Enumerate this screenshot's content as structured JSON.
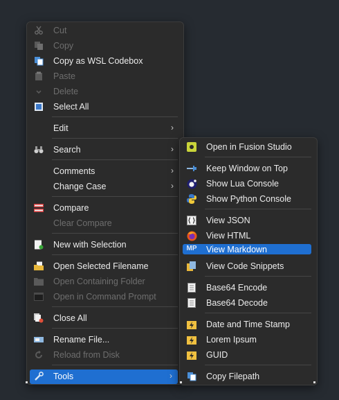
{
  "main_menu": {
    "items": [
      {
        "label": "Cut",
        "icon": "scissors-icon",
        "disabled": true
      },
      {
        "label": "Copy",
        "icon": "copy-icon",
        "disabled": true
      },
      {
        "label": "Copy as WSL Codebox",
        "icon": "copy-icon",
        "disabled": false
      },
      {
        "label": "Paste",
        "icon": "paste-icon",
        "disabled": true
      },
      {
        "label": "Delete",
        "icon": "delete-icon",
        "disabled": true
      },
      {
        "label": "Select All",
        "icon": "select-all-icon",
        "disabled": false
      },
      {
        "label": "Edit",
        "submenu": true
      },
      {
        "label": "Search",
        "icon": "binoculars-icon",
        "submenu": true
      },
      {
        "label": "Comments",
        "submenu": true
      },
      {
        "label": "Change Case",
        "submenu": true
      },
      {
        "label": "Compare",
        "icon": "compare-icon",
        "disabled": false
      },
      {
        "label": "Clear Compare",
        "disabled": true
      },
      {
        "label": "New with Selection",
        "icon": "new-document-icon",
        "disabled": false
      },
      {
        "label": "Open Selected Filename",
        "icon": "open-folder-icon",
        "disabled": false
      },
      {
        "label": "Open Containing Folder",
        "icon": "folder-icon",
        "disabled": true
      },
      {
        "label": "Open in Command Prompt",
        "icon": "command-prompt-icon",
        "disabled": true
      },
      {
        "label": "Close All",
        "icon": "close-all-icon",
        "disabled": false
      },
      {
        "label": "Rename File...",
        "icon": "rename-icon",
        "disabled": false
      },
      {
        "label": "Reload from Disk",
        "icon": "reload-icon",
        "disabled": true
      },
      {
        "label": "Tools",
        "icon": "tools-icon",
        "submenu": true,
        "highlighted": true
      }
    ]
  },
  "tools_submenu": {
    "items": [
      {
        "label": "Open in Fusion Studio",
        "icon": "fusion-icon"
      },
      {
        "label": "Keep Window on Top",
        "icon": "pin-icon"
      },
      {
        "label": "Show Lua Console",
        "icon": "lua-icon"
      },
      {
        "label": "Show Python Console",
        "icon": "python-icon"
      },
      {
        "label": "View JSON",
        "icon": "json-icon"
      },
      {
        "label": "View HTML",
        "icon": "firefox-icon"
      },
      {
        "label": "View Markdown",
        "icon": "markdown-icon",
        "highlighted": true
      },
      {
        "label": "View Code Snippets",
        "icon": "snippets-icon"
      },
      {
        "label": "Base64 Encode",
        "icon": "document-icon"
      },
      {
        "label": "Base64 Decode",
        "icon": "document-icon"
      },
      {
        "label": "Date and Time Stamp",
        "icon": "lightning-icon"
      },
      {
        "label": "Lorem Ipsum",
        "icon": "lightning-icon"
      },
      {
        "label": "GUID",
        "icon": "lightning-icon"
      },
      {
        "label": "Copy Filepath",
        "icon": "copy-icon"
      }
    ]
  },
  "icon_glyphs": {
    "markdown_text": "MP",
    "lua_text": "L"
  },
  "colors": {
    "highlight": "#1f6fd1",
    "menu_bg": "#2b2b2b",
    "disabled_text": "#6e6e6e"
  }
}
